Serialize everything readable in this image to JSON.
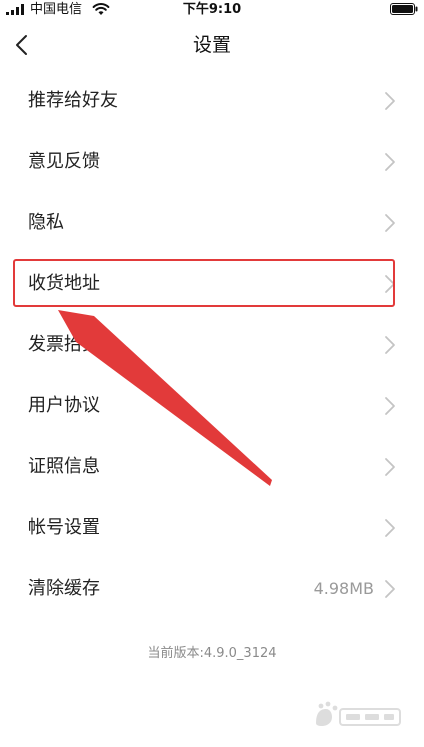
{
  "status_bar": {
    "carrier": "中国电信",
    "time": "下午9:10",
    "icons": [
      "signal-icon",
      "wifi-icon",
      "battery-icon"
    ]
  },
  "nav": {
    "title": "设置",
    "back_icon": "chevron-left-icon"
  },
  "menu": {
    "items": [
      {
        "label": "推荐给好友"
      },
      {
        "label": "意见反馈"
      },
      {
        "label": "隐私"
      },
      {
        "label": "收货地址",
        "highlighted": true
      },
      {
        "label": "发票抬头"
      },
      {
        "label": "用户协议"
      },
      {
        "label": "证照信息"
      },
      {
        "label": "帐号设置"
      },
      {
        "label": "清除缓存",
        "value": "4.98MB"
      }
    ]
  },
  "footer": {
    "version": "当前版本:4.9.0_3124"
  },
  "annotation": {
    "color": "#e23a3a"
  },
  "colors": {
    "background": "#ffffff",
    "chevron": "#c4c4c4",
    "secondary_text": "#9a9a9a"
  }
}
